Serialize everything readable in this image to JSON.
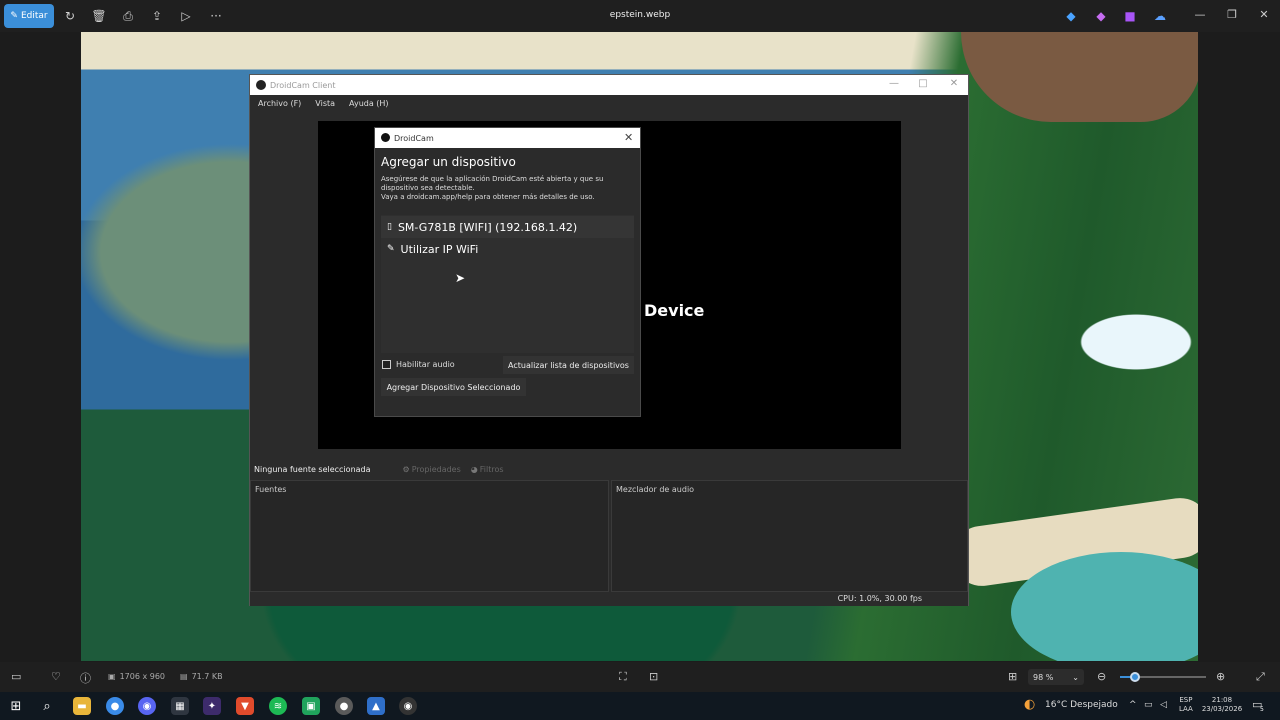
{
  "viewer": {
    "edit_label": "Editar",
    "filename": "epstein.webp",
    "dimensions": "1706 x 960",
    "filesize": "71.7 KB",
    "zoom": "98 %"
  },
  "droidcam": {
    "title": "DroidCam Client",
    "menu": [
      "Archivo (F)",
      "Vista",
      "Ayuda (H)"
    ],
    "preview_label": "Device",
    "source_bar": {
      "status": "Ninguna fuente seleccionada",
      "props": "Propiedades",
      "filters": "Filtros"
    },
    "panel_fuentes": "Fuentes",
    "panel_mixer": "Mezclador de audio",
    "status": "CPU: 1.0%, 30.00 fps"
  },
  "dialog": {
    "title": "DroidCam",
    "heading": "Agregar un dispositivo",
    "desc1": "Asegúrese de que la aplicación DroidCam esté abierta y que su",
    "desc2": "dispositivo sea detectable.",
    "desc3": "Vaya a droidcam.app/help para obtener más detalles de uso.",
    "devices": [
      {
        "label": "SM-G781B [WIFI] (192.168.1.42)",
        "icon": "phone-icon"
      },
      {
        "label": "Utilizar IP WiFi",
        "icon": "edit-icon"
      }
    ],
    "audio_label": "Habilitar audio",
    "refresh_label": "Actualizar lista de dispositivos",
    "add_label": "Agregar Dispositivo Seleccionado"
  },
  "taskbar": {
    "weather": "16°C  Despejado",
    "lang1": "ESP",
    "lang2": "LAA",
    "time": "21:08",
    "date": "23/03/2026",
    "notif": "5"
  },
  "colors": {
    "accent": "#3b8fd9",
    "dialog_bg": "#2b2b2b"
  }
}
